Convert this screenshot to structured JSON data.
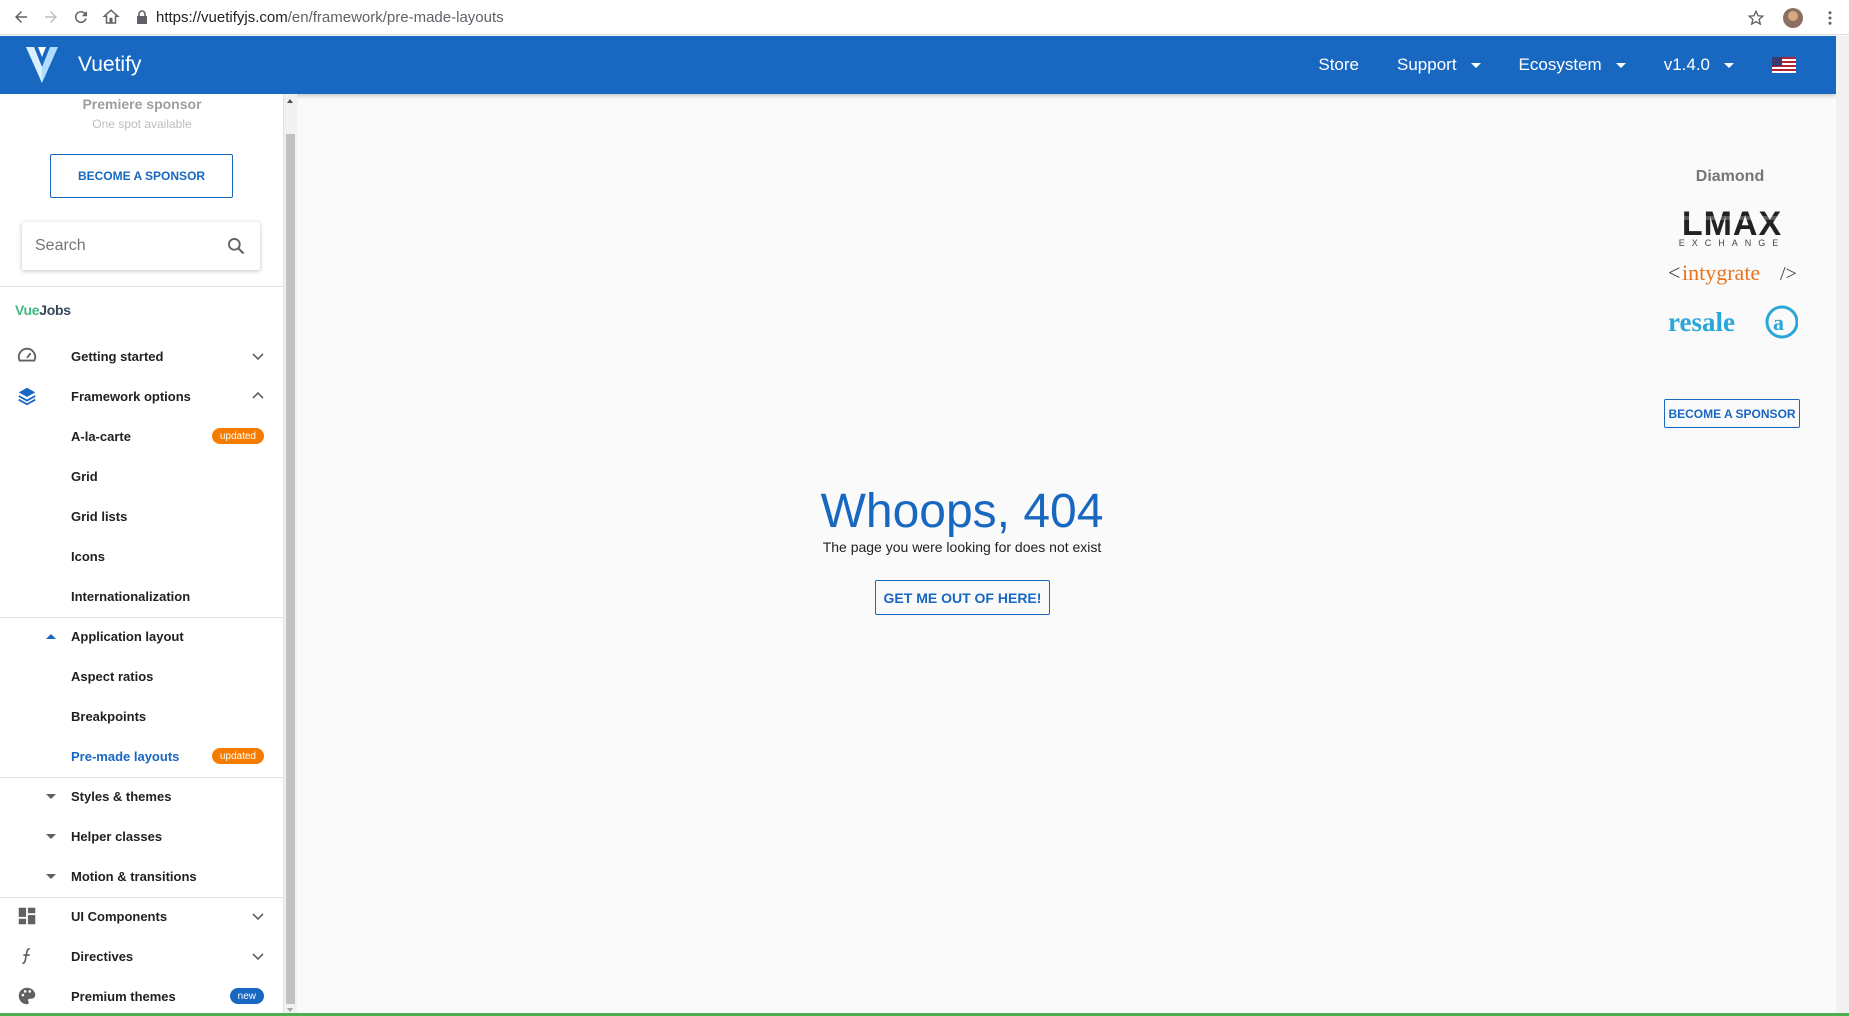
{
  "browser": {
    "url_host": "https://vuetifyjs.com",
    "url_path": "/en/framework/pre-made-layouts"
  },
  "appbar": {
    "brand": "Vuetify",
    "menu": [
      {
        "label": "Store"
      },
      {
        "label": "Support"
      },
      {
        "label": "Ecosystem"
      },
      {
        "label": "v1.4.0"
      }
    ]
  },
  "sidebar": {
    "premiere_title": "Premiere sponsor",
    "premiere_subtitle": "One spot available",
    "sponsor_button": "BECOME A SPONSOR",
    "search_placeholder": "Search",
    "vuejobs_vue": "Vue",
    "vuejobs_jobs": "Jobs",
    "items": [
      {
        "label": "Getting started"
      },
      {
        "label": "Framework options"
      },
      {
        "label": "A-la-carte",
        "badge": "updated"
      },
      {
        "label": "Grid"
      },
      {
        "label": "Grid lists"
      },
      {
        "label": "Icons"
      },
      {
        "label": "Internationalization"
      },
      {
        "label": "Application layout"
      },
      {
        "label": "Aspect ratios"
      },
      {
        "label": "Breakpoints"
      },
      {
        "label": "Pre-made layouts",
        "badge": "updated"
      },
      {
        "label": "Styles & themes"
      },
      {
        "label": "Helper classes"
      },
      {
        "label": "Motion & transitions"
      },
      {
        "label": "UI Components"
      },
      {
        "label": "Directives"
      },
      {
        "label": "Premium themes",
        "badge": "new"
      }
    ]
  },
  "main": {
    "heading": "Whoops, 404",
    "message": "The page you were looking for does not exist",
    "button": "GET ME OUT OF HERE!"
  },
  "right_sponsors": {
    "title": "Diamond",
    "logos": [
      "LMAX",
      "EXCHANGE",
      "intygrate",
      "resale"
    ],
    "button": "BECOME A SPONSOR"
  },
  "colors": {
    "primary": "#1867c0",
    "badge_orange": "#f57c00"
  }
}
